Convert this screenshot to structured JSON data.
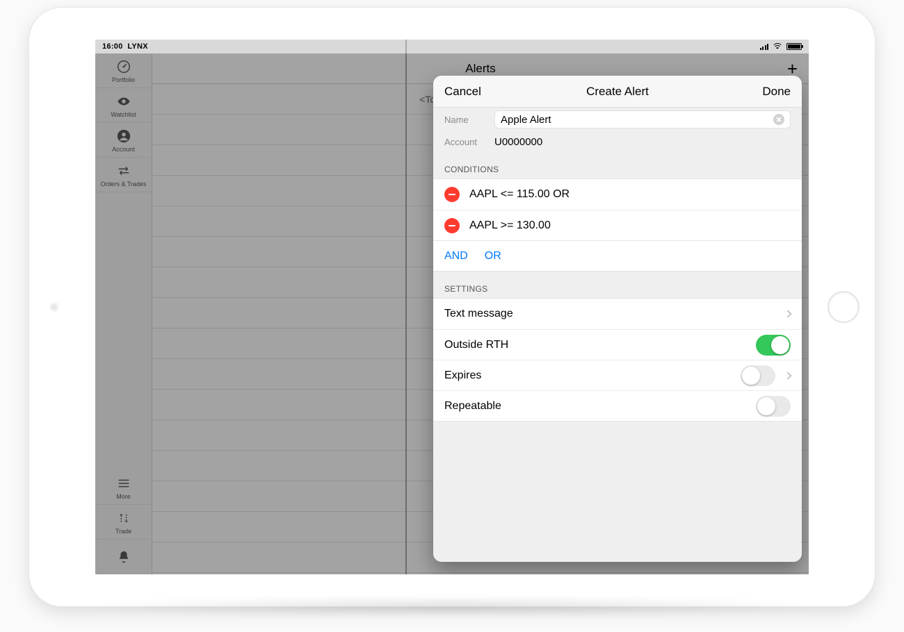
{
  "status": {
    "time": "16:00",
    "carrier": "LYNX"
  },
  "sidebar": {
    "items": [
      {
        "label": "Portfolio"
      },
      {
        "label": "Watchlist"
      },
      {
        "label": "Account"
      },
      {
        "label": "Orders & Trades"
      }
    ],
    "bottom": [
      {
        "label": "More"
      },
      {
        "label": "Trade"
      }
    ]
  },
  "list": {
    "title": "Alerts",
    "placeholder": "<Touch + to create an Alert>"
  },
  "popover": {
    "cancel": "Cancel",
    "title": "Create Alert",
    "done": "Done",
    "name_label": "Name",
    "name_value": "Apple Alert",
    "account_label": "Account",
    "account_value": "U0000000",
    "conditions_title": "CONDITIONS",
    "conditions": [
      {
        "text": "AAPL <= 115.00 OR"
      },
      {
        "text": "AAPL >= 130.00"
      }
    ],
    "logic": {
      "and": "AND",
      "or": "OR"
    },
    "settings_title": "SETTINGS",
    "settings": {
      "text_message": {
        "label": "Text message"
      },
      "outside_rth": {
        "label": "Outside RTH",
        "on": true
      },
      "expires": {
        "label": "Expires",
        "on": false
      },
      "repeatable": {
        "label": "Repeatable",
        "on": false
      }
    }
  }
}
